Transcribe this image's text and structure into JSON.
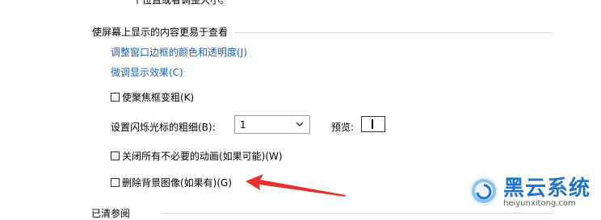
{
  "top_partial_text": "一个位置或者调整大小。",
  "section": {
    "title": "使屏幕上显示的内容更易于查看",
    "links": [
      "调整窗口边框的颜色和透明度(J)",
      "微调显示效果(C)"
    ]
  },
  "checkboxes": {
    "focus_thick": {
      "label": "使聚焦框变粗(K)",
      "checked": false
    },
    "disable_animations": {
      "label": "关闭所有不必要的动画(如果可能)(W)",
      "checked": false
    },
    "remove_background": {
      "label": "删除背景图像(如果有)(G)",
      "checked": false
    }
  },
  "cursor_thickness": {
    "label": "设置闪烁光标的粗细(B):",
    "selected_value": "1",
    "preview_label": "预览:"
  },
  "next_section_partial": "已清参阅",
  "annotation": {
    "color": "#e8312a",
    "shape": "arrow"
  },
  "watermark": {
    "title": "黑云系统",
    "url": "heiyunxitong.com",
    "brand_color": "#2274c8"
  }
}
